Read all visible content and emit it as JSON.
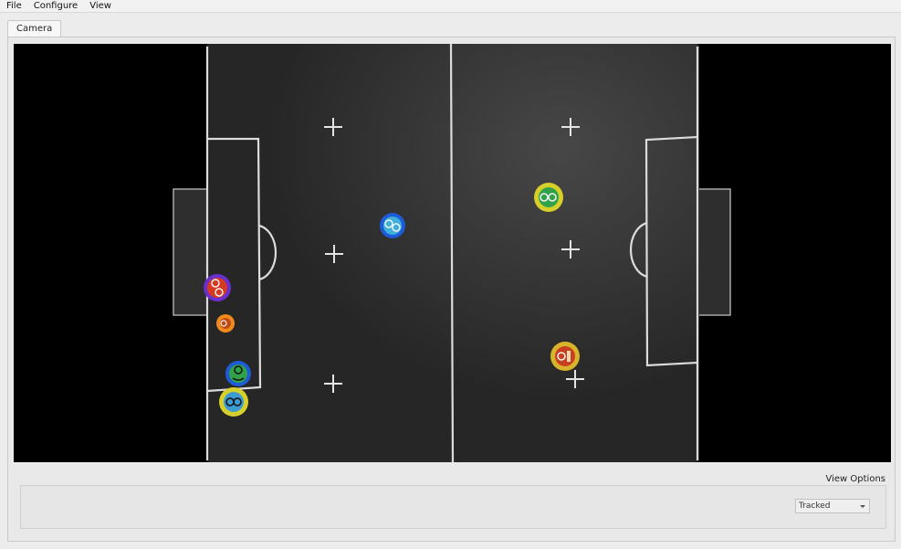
{
  "menu": {
    "file": "File",
    "configure": "Configure",
    "view": "View"
  },
  "tabs": {
    "camera": "Camera"
  },
  "view_options": {
    "label": "View Options",
    "mode_selected": "Tracked"
  },
  "colors": {
    "field": "#262626",
    "lines": "#d9d9d9",
    "blue_team": "#1e5bd8",
    "yellow_team": "#d8d02a",
    "ball": "#f08a1c"
  },
  "markers": [
    {
      "name": "robot-blue-center",
      "team": "blue"
    },
    {
      "name": "robot-blue-left-bottom",
      "team": "blue"
    },
    {
      "name": "robot-yellow-right-top",
      "team": "yellow"
    },
    {
      "name": "robot-yellow-right-bottom",
      "team": "yellow"
    },
    {
      "name": "robot-yellow-left-bottom",
      "team": "yellow"
    },
    {
      "name": "robot-red-left-goal",
      "team": "red"
    },
    {
      "name": "ball",
      "team": "ball"
    }
  ]
}
